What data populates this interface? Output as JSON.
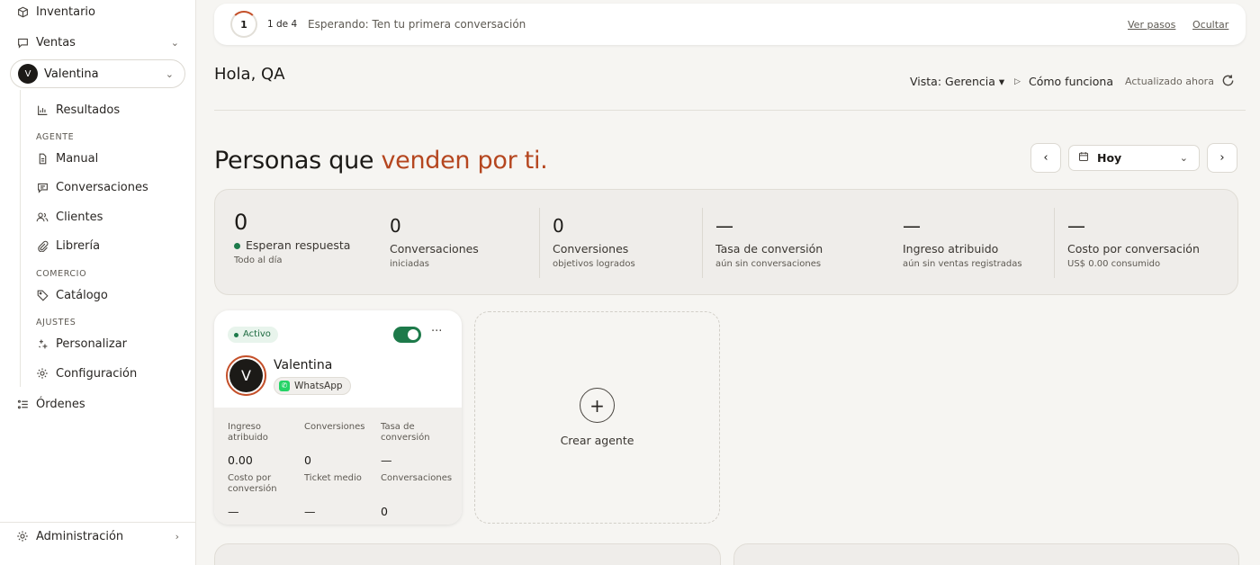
{
  "sidebar": {
    "inventario": "Inventario",
    "ventas": "Ventas",
    "agent_name": "Valentina",
    "agent_initial": "V",
    "resultados": "Resultados",
    "section_agente": "AGENTE",
    "manual": "Manual",
    "conversaciones": "Conversaciones",
    "clientes": "Clientes",
    "libreria": "Librería",
    "section_comercio": "COMERCIO",
    "catalogo": "Catálogo",
    "section_ajustes": "AJUSTES",
    "personalizar": "Personalizar",
    "configuracion": "Configuración",
    "ordenes": "Órdenes",
    "administracion": "Administración"
  },
  "onboarding": {
    "step": "1",
    "count": "1 de 4",
    "text": "Esperando: Ten tu primera conversación",
    "ver_pasos": "Ver pasos",
    "ocultar": "Ocultar"
  },
  "header": {
    "greeting": "Hola, QA",
    "view": "Vista: Gerencia ▾",
    "how": "Cómo funciona",
    "updated": "Actualizado ahora"
  },
  "headline": {
    "prefix": "Personas que ",
    "accent": "venden por ti."
  },
  "date_select": {
    "value": "Hoy"
  },
  "stats": [
    {
      "value": "0",
      "label": "Esperan respuesta",
      "sub": "Todo al día"
    },
    {
      "value": "0",
      "label": "Conversaciones",
      "sub": "iniciadas"
    },
    {
      "value": "0",
      "label": "Conversiones",
      "sub": "objetivos logrados"
    },
    {
      "value": "—",
      "label": "Tasa de conversión",
      "sub": "aún sin conversaciones"
    },
    {
      "value": "—",
      "label": "Ingreso atribuido",
      "sub": "aún sin ventas registradas"
    },
    {
      "value": "—",
      "label": "Costo por conversación",
      "sub": "US$ 0.00 consumido"
    }
  ],
  "agent_card": {
    "status": "Activo",
    "more": "···",
    "initial": "V",
    "name": "Valentina",
    "channel": "WhatsApp",
    "metrics": [
      {
        "label": "Ingreso atribuido",
        "value": "0.00"
      },
      {
        "label": "Conversiones",
        "value": "0"
      },
      {
        "label": "Tasa de conversión",
        "value": "—"
      },
      {
        "label": "Costo por conversión",
        "value": "—"
      },
      {
        "label": "Ticket medio",
        "value": "—"
      },
      {
        "label": "Conversaciones",
        "value": "0"
      }
    ]
  },
  "create_agent": {
    "label": "Crear agente",
    "plus": "+"
  },
  "colors": {
    "accent": "#b5461f",
    "active_green": "#1d7a4a",
    "whatsapp": "#25d366"
  },
  "icons": [
    "box-icon",
    "chat-icon",
    "chart-icon",
    "document-icon",
    "users-icon",
    "paperclip-icon",
    "tag-icon",
    "sparkle-icon",
    "gear-icon",
    "list-icon",
    "play-icon",
    "refresh-icon",
    "calendar-icon",
    "chevron-left-icon",
    "chevron-right-icon",
    "chevron-down-icon",
    "plus-icon",
    "whatsapp-icon"
  ]
}
